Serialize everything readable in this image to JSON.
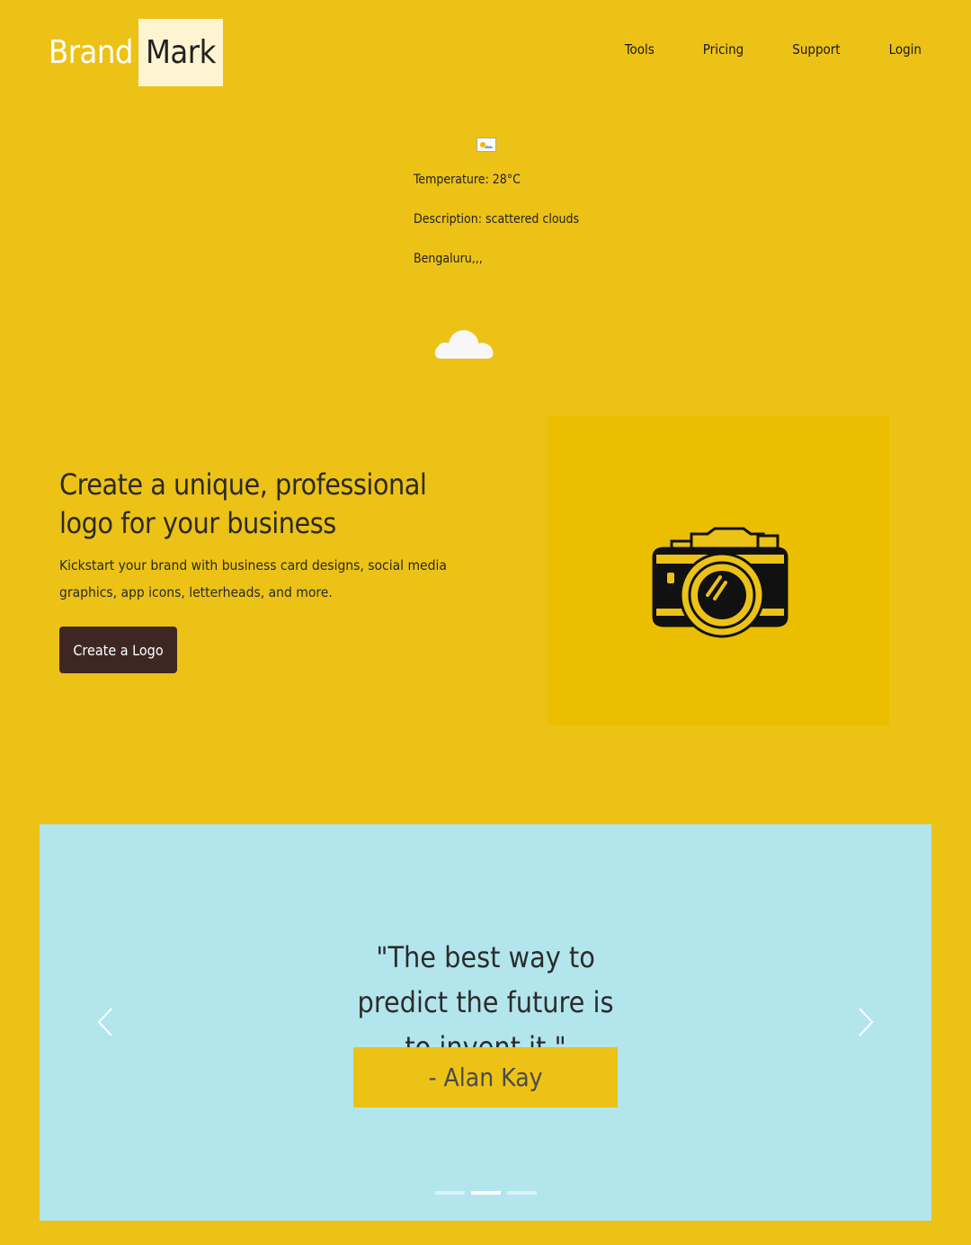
{
  "header": {
    "logo_brand": "Brand",
    "logo_mark": "Mark",
    "nav": [
      "Tools",
      "Pricing",
      "Support",
      "Login"
    ]
  },
  "weather": {
    "temperature": "Temperature: 28°C",
    "description": "Description: scattered clouds",
    "location": "Bengaluru,,,",
    "icon": "weather-icon",
    "condition_icon": "cloud-icon"
  },
  "hero": {
    "title": "Create a unique, professional logo for your business",
    "subtitle": "Kickstart your brand with business card designs, social media graphics, app icons, letterheads, and more.",
    "cta_label": "Create a Logo",
    "image_icon": "camera-icon"
  },
  "testimonial": {
    "quote": "\"The best way to predict the future is to invent it.\"",
    "author": "- Alan Kay",
    "active_slide": 2,
    "slide_count": 3
  },
  "colors": {
    "page_background": "#ECC216",
    "logo_mark_background": "#FFF4D2",
    "cta_background": "#3E2723",
    "hero_image_background": "#EBBF00",
    "carousel_background": "#B2E6EC"
  }
}
